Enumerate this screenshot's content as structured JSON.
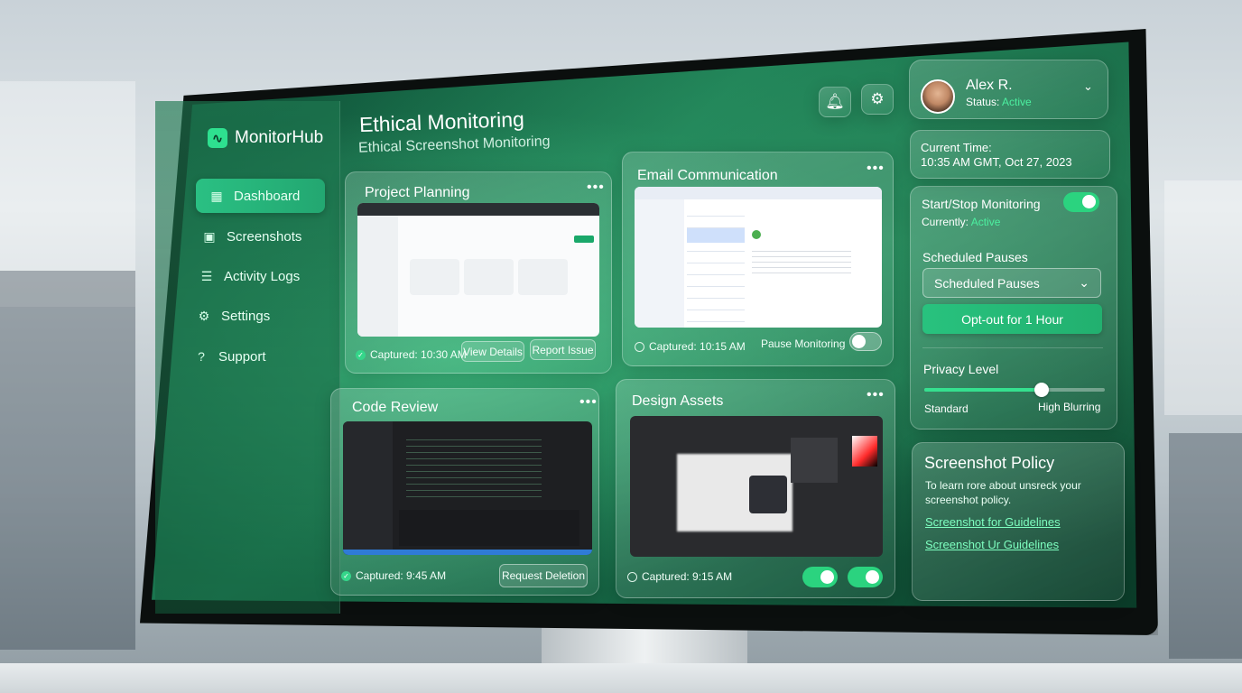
{
  "app": {
    "name": "MonitorHub"
  },
  "sidebar": {
    "items": [
      {
        "label": "Dashboard",
        "icon": "grid-icon",
        "active": true
      },
      {
        "label": "Screenshots",
        "icon": "image-icon",
        "active": false
      },
      {
        "label": "Activity Logs",
        "icon": "list-icon",
        "active": false
      },
      {
        "label": "Settings",
        "icon": "gear-icon",
        "active": false
      },
      {
        "label": "Support",
        "icon": "help-icon",
        "active": false
      }
    ]
  },
  "header": {
    "title": "Ethical Monitoring",
    "subtitle": "Ethical Screenshot Monitoring"
  },
  "user": {
    "name": "Alex R.",
    "status_label": "Status:",
    "status_value": "Active"
  },
  "cards": [
    {
      "title": "Project Planning",
      "captured": "Captured: 10:30 AM",
      "actions": [
        "View Details",
        "Report Issue"
      ]
    },
    {
      "title": "Email Communication",
      "captured": "Captured: 10:15 AM",
      "toggle_label": "Pause Monitoring",
      "toggle_on": false
    },
    {
      "title": "Code Review",
      "captured": "Captured: 9:45 AM",
      "actions": [
        "Request Deletion"
      ]
    },
    {
      "title": "Design Assets",
      "captured": "Captured: 9:15 AM",
      "toggles": [
        true,
        true
      ]
    }
  ],
  "time_panel": {
    "label": "Current Time:",
    "value": "10:35 AM GMT, Oct 27, 2023"
  },
  "monitoring": {
    "title": "Start/Stop Monitoring",
    "enabled": true,
    "currently_label": "Currently:",
    "currently_value": "Active",
    "scheduled_label": "Scheduled Pauses",
    "scheduled_select": "Scheduled Pauses",
    "opt_out_button": "Opt-out for 1 Hour",
    "privacy_label": "Privacy Level",
    "privacy_level": 0.65,
    "privacy_min": "Standard",
    "privacy_max": "High Blurring"
  },
  "policy": {
    "title": "Screenshot Policy",
    "text": "To learn rore about unsreck your screenshot policy.",
    "links": [
      "Screenshot for Guidelines",
      "Screenshot Ur Guidelines"
    ]
  },
  "colors": {
    "accent": "#2ac083",
    "active_text": "#4cf0a0",
    "background": "#145f40"
  }
}
